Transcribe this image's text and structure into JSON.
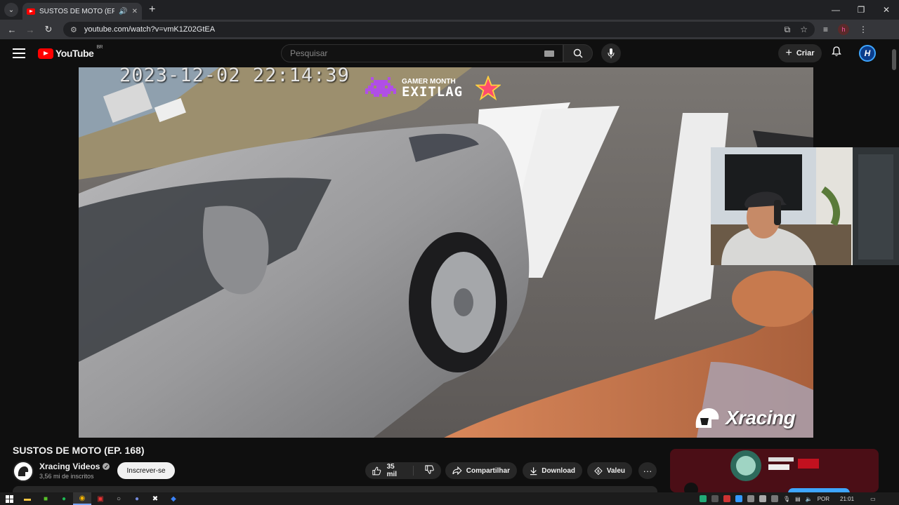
{
  "browser": {
    "tab_title": "SUSTOS DE MOTO (EP. 168)",
    "tab_close": "✕",
    "new_tab": "+",
    "url": "youtube.com/watch?v=vmK1Z02GtEA",
    "window_controls": [
      "—",
      "❐",
      "✕"
    ]
  },
  "youtube": {
    "logo_text": "YouTube",
    "region": "BR",
    "search_placeholder": "Pesquisar",
    "create_label": "Criar",
    "avatar_letter": "H"
  },
  "video": {
    "overlay_timestamp": "2023-12-02 22:14:39",
    "sponsor_top": "GAMER MONTH",
    "sponsor_name": "EXITLAG",
    "brand_watermark": "Xracing"
  },
  "meta": {
    "title": "SUSTOS DE MOTO (EP. 168)",
    "channel_name": "Xracing Videos",
    "subscribers": "3,56 mi de inscritos",
    "subscribe_label": "Inscrever-se",
    "likes": "35 mil",
    "share_label": "Compartilhar",
    "download_label": "Download",
    "thanks_label": "Valeu",
    "more_label": "···"
  },
  "taskbar": {
    "language": "POR",
    "time": "21:01"
  },
  "colors": {
    "brand_red": "#ff0000",
    "background": "#0f0f0f",
    "accent_blue": "#3ea6ff"
  }
}
